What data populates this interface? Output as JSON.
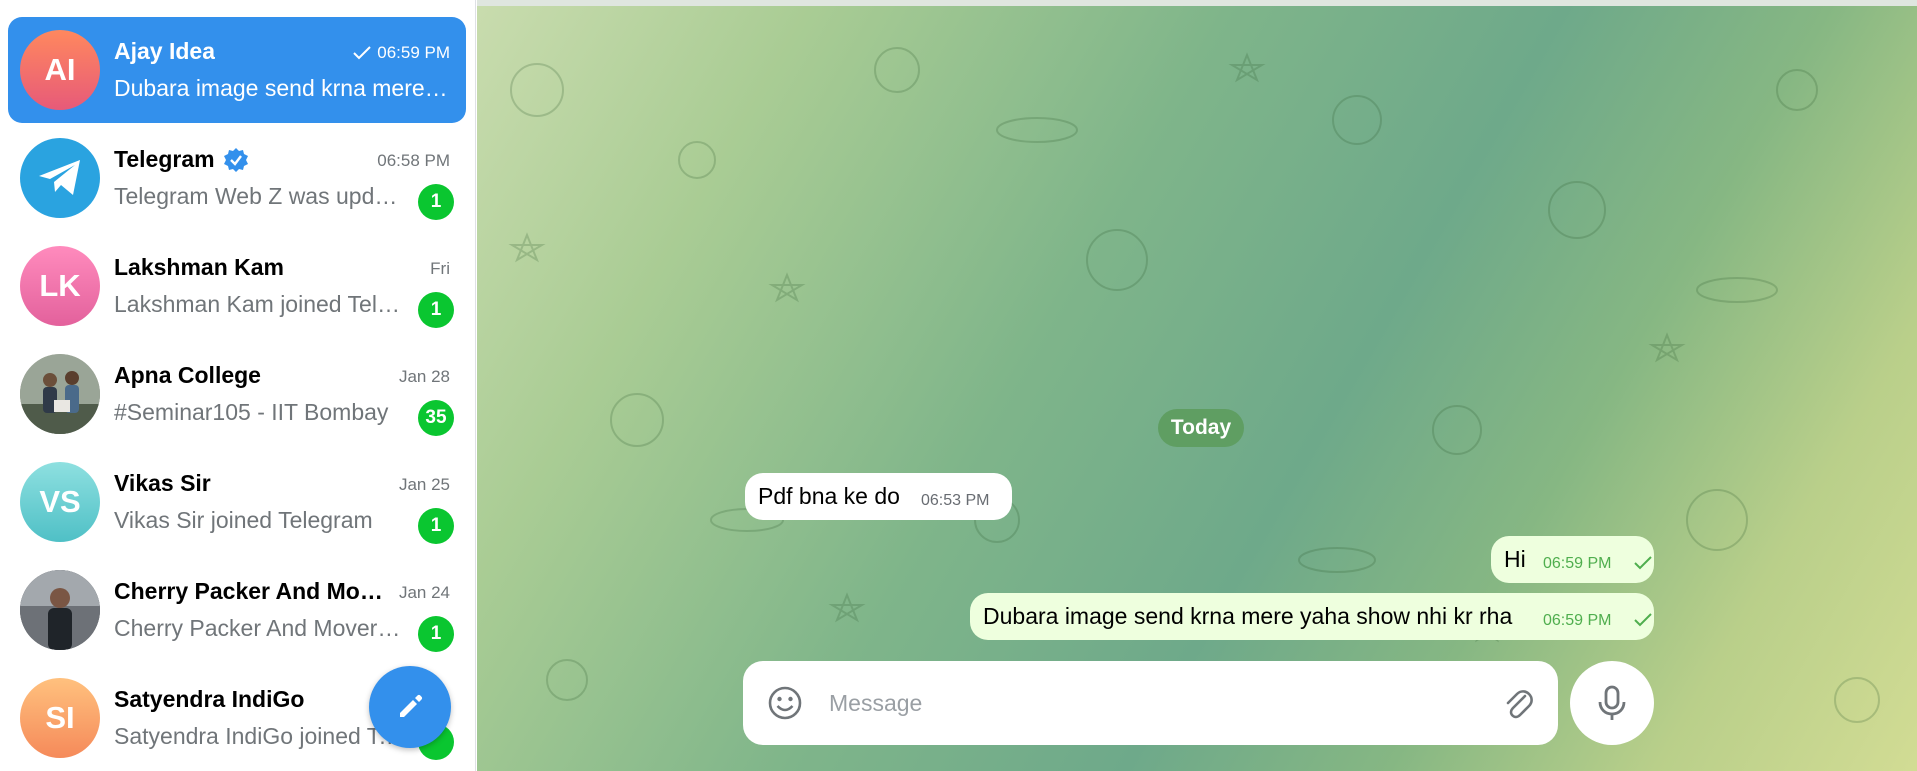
{
  "sidebar": {
    "chats": [
      {
        "name": "Ajay Idea",
        "initials": "AI",
        "time": "06:59 PM",
        "preview": "Dubara image send krna mere yaha show nhi kr rha",
        "read": true,
        "active": true,
        "color_from": "#ff885e",
        "color_to": "#e75a79"
      },
      {
        "name": "Telegram",
        "time": "06:58 PM",
        "preview": "Telegram Web Z was updated",
        "badge": "1",
        "verified": true,
        "icon": "telegram-logo"
      },
      {
        "name": "Lakshman Kam",
        "initials": "LK",
        "time": "Fri",
        "preview": "Lakshman Kam joined Telegram",
        "badge": "1",
        "color_from": "#ff8bbd",
        "color_to": "#e3619c"
      },
      {
        "name": "Apna College",
        "time": "Jan 28",
        "preview": "#Seminar105 - IIT Bombay",
        "badge": "35",
        "photo": "group-photo"
      },
      {
        "name": "Vikas Sir",
        "initials": "VS",
        "time": "Jan 25",
        "preview": "Vikas Sir joined Telegram",
        "badge": "1",
        "color_from": "#8ee0e0",
        "color_to": "#4fc0c6"
      },
      {
        "name": "Cherry Packer And Movers",
        "time": "Jan 24",
        "preview": "Cherry Packer And Movers joined Telegram",
        "badge": "1",
        "photo": "person-photo"
      },
      {
        "name": "Satyendra IndiGo",
        "initials": "SI",
        "preview": "Satyendra IndiGo joined Telegram",
        "color_from": "#ffc17e",
        "color_to": "#f58a5a"
      }
    ],
    "compose_icon": "pencil-icon"
  },
  "chat": {
    "date_label": "Today",
    "messages": [
      {
        "text": "Pdf bna ke do",
        "time": "06:53 PM",
        "direction": "incoming"
      },
      {
        "text": "Hi",
        "time": "06:59 PM",
        "direction": "outgoing",
        "status": "sent"
      },
      {
        "text": "Dubara image send krna mere yaha show nhi kr rha",
        "time": "06:59 PM",
        "direction": "outgoing",
        "status": "sent"
      }
    ],
    "composer": {
      "placeholder": "Message"
    }
  },
  "colors": {
    "accent": "#3390ec",
    "badge": "#0ac630",
    "outgoing_bubble": "#eeffde",
    "date_pill": "#5f9e62"
  }
}
